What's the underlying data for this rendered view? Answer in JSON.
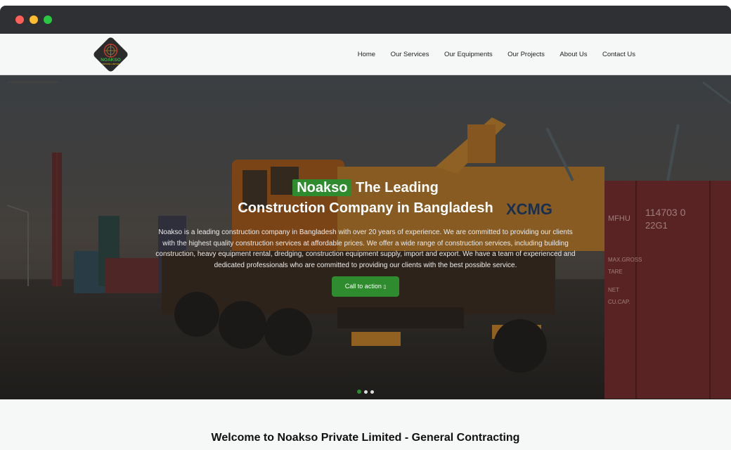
{
  "window": {
    "controls": [
      "close",
      "minimize",
      "maximize"
    ]
  },
  "brand": {
    "logo_text": "NOAKSO",
    "logo_subtext": "PRIVATE LIMITED",
    "accent_color": "#2e8b2e"
  },
  "nav": {
    "items": [
      {
        "label": "Home"
      },
      {
        "label": "Our Services"
      },
      {
        "label": "Our Equipments"
      },
      {
        "label": "Our Projects"
      },
      {
        "label": "About Us"
      },
      {
        "label": "Contact Us"
      }
    ]
  },
  "hero": {
    "highlight": "Noakso",
    "headline_rest": "The Leading",
    "headline_line2": "Construction Company in Bangladesh",
    "description": "Noakso is a leading construction company in Bangladesh with over 20 years of experience. We are committed to providing our clients with the highest quality construction services at affordable prices. We offer a wide range of construction services, including building construction, heavy equipment rental, dredging, construction equipment supply, import and export. We have a team of experienced and dedicated professionals who are committed to providing our clients with the best possible service.",
    "cta_label": "Call to action ",
    "cta_icon": "arrow-icon",
    "slides": 3,
    "active_slide": 1,
    "photo_text": {
      "crane_brand": "XCMG",
      "container_code": "114703 0",
      "container_sub": "22G1",
      "container_label1": "MFHU",
      "container_label2": "MAX.GROSS",
      "container_label3": "TARE",
      "container_label4": "NET",
      "container_label5": "CU.CAP."
    }
  },
  "welcome": {
    "heading": "Welcome to Noakso Private Limited - General Contracting"
  }
}
